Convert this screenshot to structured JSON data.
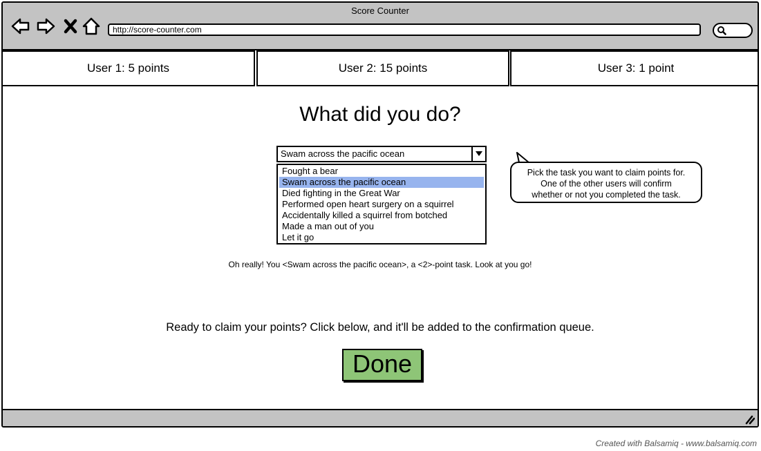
{
  "window": {
    "title": "Score Counter",
    "url": "http://score-counter.com"
  },
  "nav_icons": [
    "back-icon",
    "forward-icon",
    "close-icon",
    "home-icon",
    "search-icon"
  ],
  "tabs": [
    {
      "label": "User 1: 5 points"
    },
    {
      "label": "User 2: 15 points"
    },
    {
      "label": "User 3: 1 point"
    }
  ],
  "main": {
    "heading": "What did you do?",
    "select": {
      "value": "Swam across the pacific ocean",
      "options": [
        "Fought a bear",
        "Swam across the pacific ocean",
        "Died fighting in the Great War",
        "Performed open heart surgery on a squirrel",
        "Accidentally killed a squirrel from botched",
        "Made a man out of you",
        "Let it go"
      ],
      "selected_index": 1
    },
    "callout": {
      "line1": "Pick the task you want to claim points for.",
      "line2": "One of the other users will confirm",
      "line3": "whether or not you completed the task."
    },
    "feedback": "Oh really! You <Swam across the pacific ocean>, a <2>-point task. Look at you go!",
    "ready_text": "Ready to claim your points? Click below, and it'll be added to the confirmation queue.",
    "done_label": "Done"
  },
  "credit": "Created with Balsamiq - www.balsamiq.com",
  "colors": {
    "chrome": "#c3c3c3",
    "selected_item": "#97b4ee",
    "done_button": "#8ec577"
  }
}
